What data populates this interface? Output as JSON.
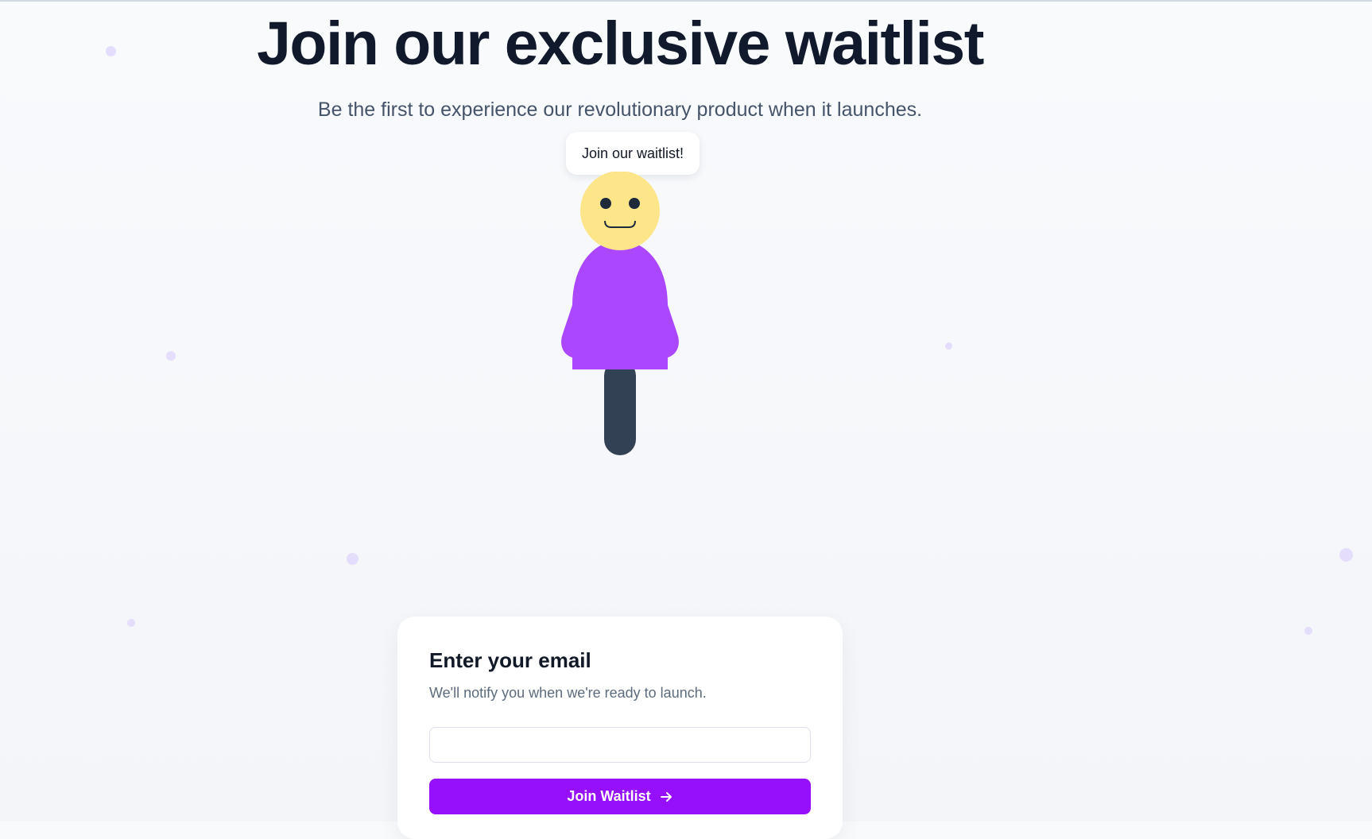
{
  "hero": {
    "title": "Join our exclusive waitlist",
    "subtitle": "Be the first to experience our revolutionary product when it launches."
  },
  "mascot": {
    "speech": "Join our waitlist!",
    "colors": {
      "head": "#fde68a",
      "body": "#ab47fe",
      "legs": "#334155"
    }
  },
  "form": {
    "title": "Enter your email",
    "description": "We'll notify you when we're ready to launch.",
    "email_value": "",
    "email_placeholder": "",
    "submit_label": "Join Waitlist",
    "submit_icon": "arrow-right-icon"
  },
  "colors": {
    "accent": "#9710fb",
    "background": "#f6f8fb",
    "heading": "#101a2c"
  }
}
